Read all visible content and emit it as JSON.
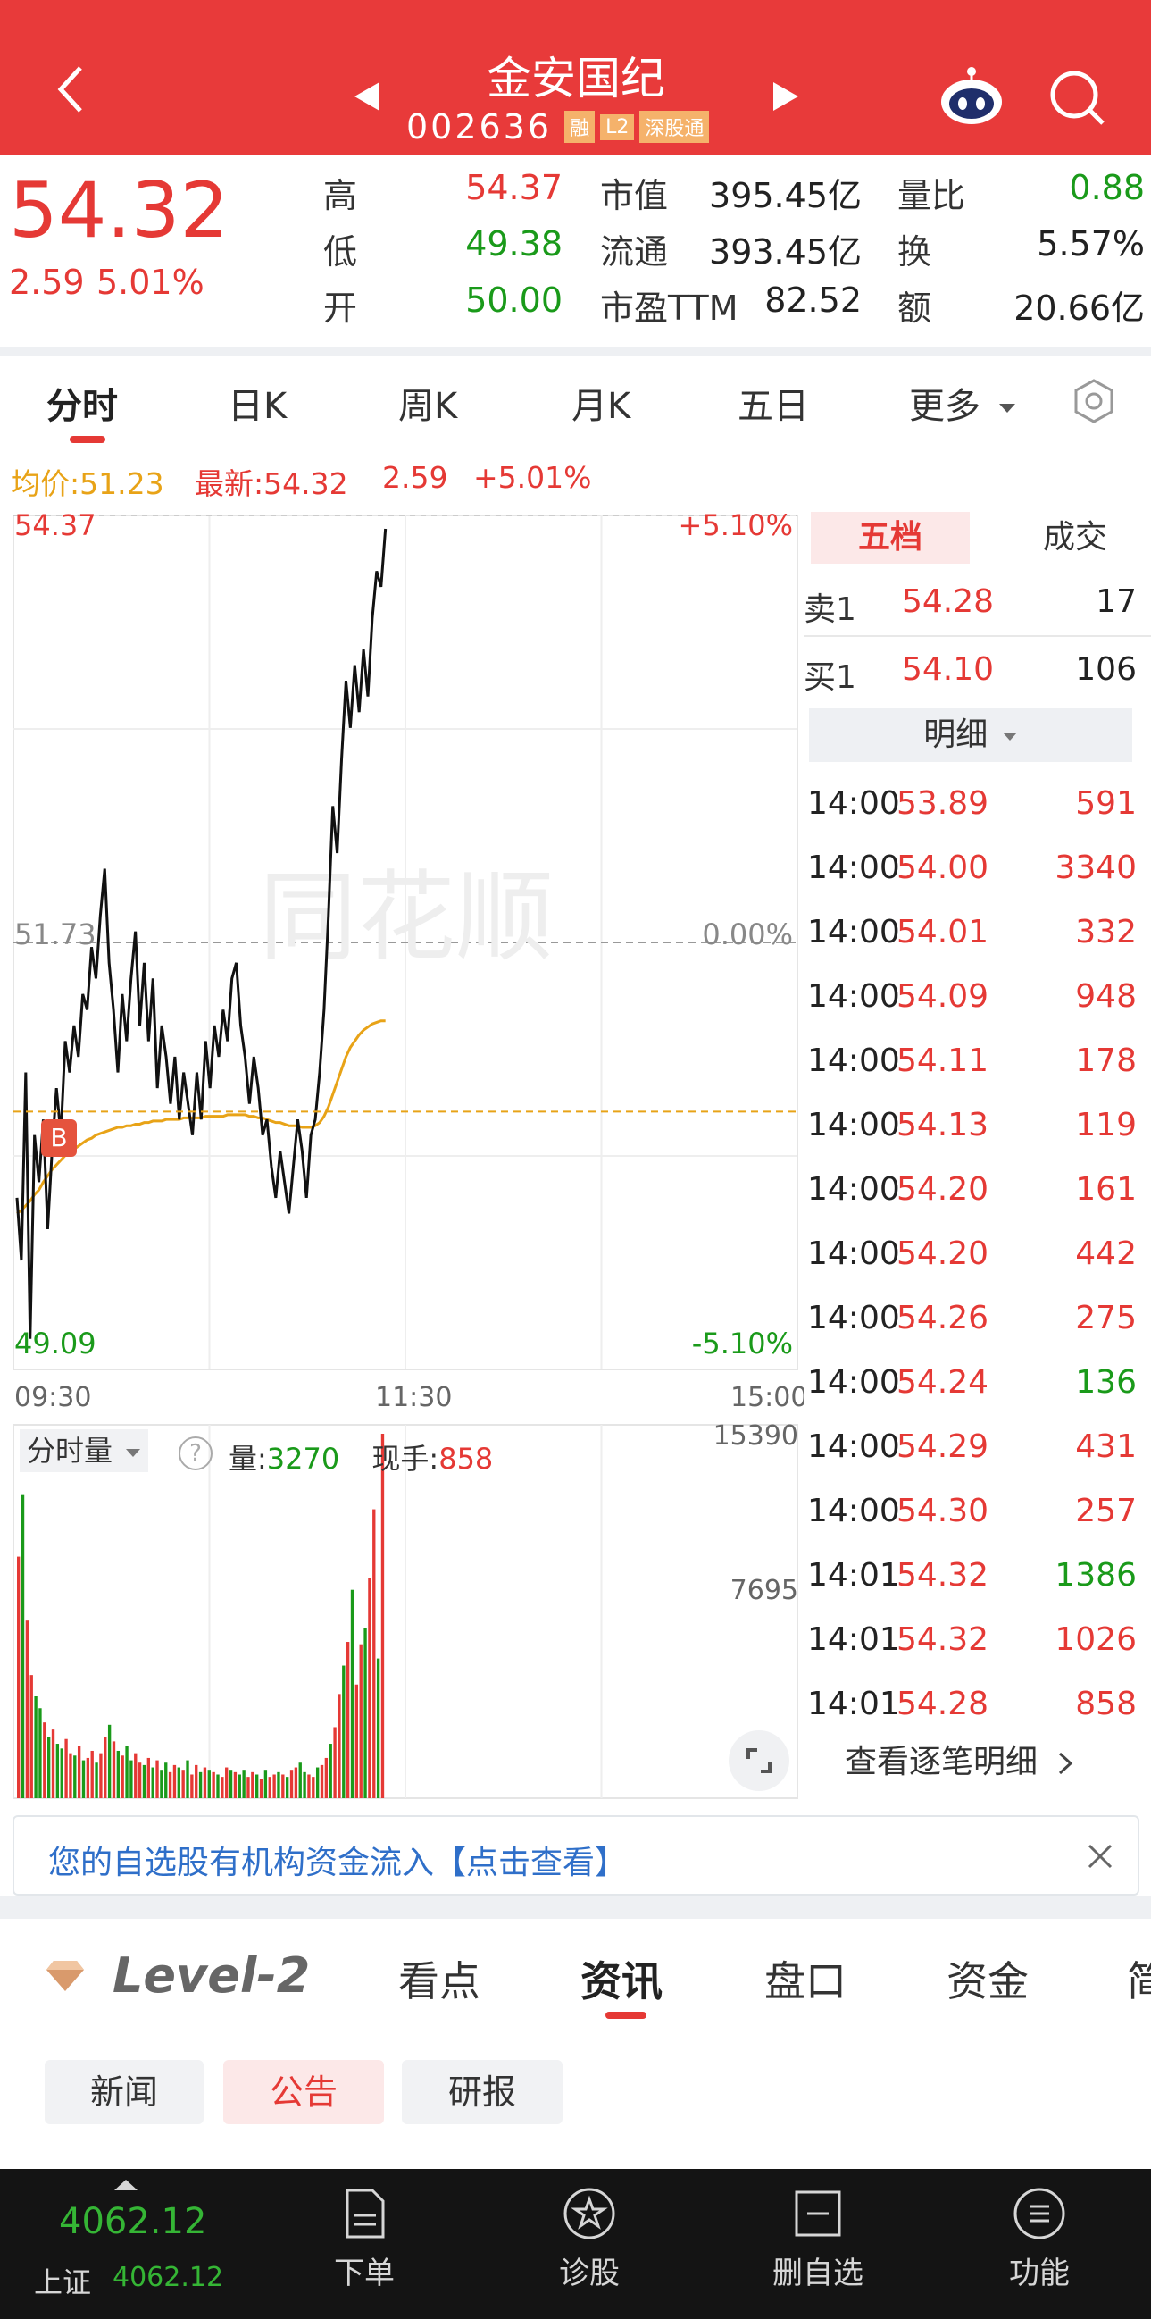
{
  "header": {
    "stock_name": "金安国纪",
    "stock_code": "002636",
    "badges": [
      "融",
      "L2",
      "深股通"
    ]
  },
  "quote": {
    "price": "54.32",
    "change": "2.59",
    "change_pct": "5.01%",
    "stats": [
      {
        "label": "高",
        "value": "54.37",
        "color": "#e53935"
      },
      {
        "label": "低",
        "value": "49.38",
        "color": "#1a9a1a"
      },
      {
        "label": "开",
        "value": "50.00",
        "color": "#1a9a1a"
      },
      {
        "label": "市值",
        "value": "395.45亿",
        "color": "#222222"
      },
      {
        "label": "流通",
        "value": "393.45亿",
        "color": "#222222"
      },
      {
        "label": "市盈TTM",
        "value": "82.52",
        "color": "#222222"
      },
      {
        "label": "量比",
        "value": "0.88",
        "color": "#1a9a1a"
      },
      {
        "label": "换",
        "value": "5.57%",
        "color": "#222222"
      },
      {
        "label": "额",
        "value": "20.66亿",
        "color": "#222222"
      }
    ]
  },
  "tabs": [
    "分时",
    "日K",
    "周K",
    "月K",
    "五日",
    "更多"
  ],
  "summary": {
    "avg_label": "均价:51.23",
    "latest_label": "最新:54.32",
    "change": "2.59",
    "change_pct": "+5.01%"
  },
  "chart_data": {
    "type": "line",
    "y_axis_left": {
      "top": "54.37",
      "mid": "51.73",
      "bottom": "49.09"
    },
    "y_axis_right": {
      "top": "+5.10%",
      "mid": "0.00%",
      "bottom": "-5.10%"
    },
    "x_ticks": [
      "09:30",
      "11:30",
      "15:00"
    ],
    "ylim": [
      49.09,
      54.37
    ],
    "marker_label": "B",
    "series": [
      {
        "values": [
          50.1,
          49.7,
          50.9,
          49.2,
          50.5,
          50.2,
          50.6,
          49.9,
          50.4,
          50.8,
          50.5,
          51.1,
          50.9,
          51.2,
          51.0,
          51.4,
          51.3,
          51.7,
          51.5,
          51.9,
          52.2,
          51.6,
          51.3,
          50.9,
          51.4,
          51.1,
          51.5,
          51.8,
          51.2,
          51.6,
          51.1,
          51.5,
          50.8,
          51.2,
          51.0,
          50.7,
          51.0,
          50.6,
          50.9,
          50.7,
          50.5,
          50.9,
          50.6,
          51.1,
          50.8,
          51.2,
          51.0,
          51.3,
          51.1,
          51.5,
          51.6,
          51.2,
          51.0,
          50.7,
          51.0,
          50.8,
          50.5,
          50.6,
          50.3,
          50.1,
          50.4,
          50.2,
          50.0,
          50.3,
          50.6,
          50.4,
          50.1,
          50.5,
          50.6,
          50.9,
          51.3,
          51.9,
          52.6,
          52.3,
          52.9,
          53.4,
          53.1,
          53.5,
          53.2,
          53.6,
          53.3,
          53.8,
          54.1,
          54.0,
          54.37
        ]
      },
      {
        "values": [
          50.0,
          50.02,
          50.05,
          50.08,
          50.12,
          50.15,
          50.2,
          50.24,
          50.28,
          50.31,
          50.34,
          50.37,
          50.39,
          50.41,
          50.43,
          50.45,
          50.47,
          50.48,
          50.5,
          50.51,
          50.52,
          50.53,
          50.54,
          50.55,
          50.55,
          50.56,
          50.56,
          50.57,
          50.57,
          50.58,
          50.58,
          50.59,
          50.59,
          50.59,
          50.6,
          50.6,
          50.6,
          50.6,
          50.61,
          50.61,
          50.61,
          50.61,
          50.61,
          50.62,
          50.62,
          50.62,
          50.62,
          50.62,
          50.63,
          50.63,
          50.63,
          50.63,
          50.63,
          50.62,
          50.62,
          50.61,
          50.61,
          50.6,
          50.59,
          50.58,
          50.58,
          50.57,
          50.56,
          50.56,
          50.56,
          50.55,
          50.55,
          50.55,
          50.56,
          50.58,
          50.62,
          50.68,
          50.76,
          50.84,
          50.92,
          51.0,
          51.06,
          51.1,
          51.14,
          51.17,
          51.19,
          51.21,
          51.22,
          51.23,
          51.23
        ]
      }
    ]
  },
  "volume": {
    "label": "分时量",
    "vol_label": "量:",
    "vol_value": "3270",
    "hand_label": "现手:",
    "hand_value": "858",
    "y_top": "15390",
    "y_mid": "7695",
    "max": 15390,
    "bars": [
      10200,
      12800,
      7500,
      5200,
      4300,
      3800,
      3200,
      2600,
      2900,
      2300,
      2100,
      2500,
      1900,
      1800,
      2200,
      1600,
      1700,
      2000,
      1500,
      1900,
      2600,
      3100,
      2400,
      2000,
      1800,
      2200,
      1600,
      1900,
      1500,
      1400,
      1700,
      1300,
      1600,
      1200,
      1500,
      1100,
      1400,
      1300,
      1200,
      1600,
      1000,
      1400,
      1100,
      1300,
      1200,
      1100,
      1000,
      900,
      1300,
      1200,
      1100,
      1000,
      1200,
      900,
      1100,
      1000,
      800,
      1200,
      900,
      1000,
      1100,
      1000,
      900,
      1200,
      1300,
      1500,
      1100,
      1000,
      900,
      1300,
      1400,
      1700,
      2300,
      3000,
      4400,
      5600,
      6600,
      8800,
      4800,
      6500,
      7200,
      9300,
      12200,
      5900,
      15390
    ],
    "bar_colors": [
      "r",
      "g",
      "r",
      "r",
      "g",
      "g",
      "r",
      "g",
      "r",
      "g",
      "g",
      "r",
      "r",
      "g",
      "r",
      "g",
      "r",
      "r",
      "g",
      "r",
      "r",
      "g",
      "r",
      "g",
      "r",
      "g",
      "g",
      "r",
      "r",
      "g",
      "r",
      "g",
      "r",
      "g",
      "g",
      "r",
      "r",
      "g",
      "r",
      "g",
      "r",
      "r",
      "g",
      "r",
      "g",
      "r",
      "g",
      "r",
      "r",
      "g",
      "r",
      "g",
      "g",
      "r",
      "r",
      "g",
      "r",
      "g",
      "r",
      "r",
      "g",
      "r",
      "g",
      "r",
      "r",
      "g",
      "g",
      "r",
      "r",
      "g",
      "r",
      "r",
      "g",
      "r",
      "r",
      "g",
      "r",
      "g",
      "r",
      "r",
      "g",
      "r",
      "r",
      "g",
      "r"
    ]
  },
  "side": {
    "tab_active": "五档",
    "tab_other": "成交",
    "sell": {
      "label": "卖1",
      "price": "54.28",
      "qty": "17"
    },
    "buy": {
      "label": "买1",
      "price": "54.10",
      "qty": "106"
    },
    "detail_label": "明细",
    "trades": [
      {
        "time": "14:00",
        "price": "53.89",
        "qty": "591",
        "c": "#e53935"
      },
      {
        "time": "14:00",
        "price": "54.00",
        "qty": "3340",
        "c": "#e53935"
      },
      {
        "time": "14:00",
        "price": "54.01",
        "qty": "332",
        "c": "#e53935"
      },
      {
        "time": "14:00",
        "price": "54.09",
        "qty": "948",
        "c": "#e53935"
      },
      {
        "time": "14:00",
        "price": "54.11",
        "qty": "178",
        "c": "#e53935"
      },
      {
        "time": "14:00",
        "price": "54.13",
        "qty": "119",
        "c": "#e53935"
      },
      {
        "time": "14:00",
        "price": "54.20",
        "qty": "161",
        "c": "#e53935"
      },
      {
        "time": "14:00",
        "price": "54.20",
        "qty": "442",
        "c": "#e53935"
      },
      {
        "time": "14:00",
        "price": "54.26",
        "qty": "275",
        "c": "#e53935"
      },
      {
        "time": "14:00",
        "price": "54.24",
        "qty": "136",
        "c": "#1a9a1a"
      },
      {
        "time": "14:00",
        "price": "54.29",
        "qty": "431",
        "c": "#e53935"
      },
      {
        "time": "14:00",
        "price": "54.30",
        "qty": "257",
        "c": "#e53935"
      },
      {
        "time": "14:01",
        "price": "54.32",
        "qty": "1386",
        "c": "#1a9a1a"
      },
      {
        "time": "14:01",
        "price": "54.32",
        "qty": "1026",
        "c": "#e53935"
      },
      {
        "time": "14:01",
        "price": "54.28",
        "qty": "858",
        "c": "#e53935"
      }
    ],
    "view_all": "查看逐笔明细"
  },
  "banner": {
    "text": "您的自选股有机构资金流入【点击查看】"
  },
  "info_tabs": {
    "level2": "Level-2",
    "items": [
      "看点",
      "资讯",
      "盘口",
      "资金",
      "简"
    ]
  },
  "news_tabs": [
    "新闻",
    "公告",
    "研报"
  ],
  "bottom_nav": {
    "index_value": "4062.12",
    "index_label": "上证",
    "index_value2": "4062.12",
    "items": [
      "下单",
      "诊股",
      "删自选",
      "功能"
    ]
  }
}
